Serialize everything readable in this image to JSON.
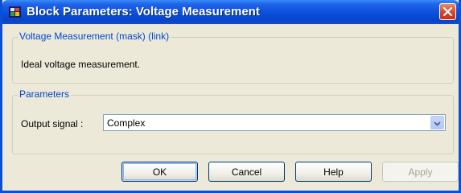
{
  "window": {
    "title": "Block Parameters: Voltage Measurement",
    "app_icon": "simulink-block-icon",
    "close_icon": "close-icon"
  },
  "description_group": {
    "legend": "Voltage Measurement (mask) (link)",
    "text": "Ideal voltage measurement."
  },
  "parameters_group": {
    "legend": "Parameters",
    "output_signal": {
      "label": "Output signal :",
      "value": "Complex"
    }
  },
  "buttons": {
    "ok": "OK",
    "cancel": "Cancel",
    "help": "Help",
    "apply": "Apply"
  },
  "colors": {
    "titlebar": "#0a4fdc",
    "legend_text": "#0046d5",
    "close_button": "#d4472a",
    "dialog_background": "#ece9d8"
  }
}
